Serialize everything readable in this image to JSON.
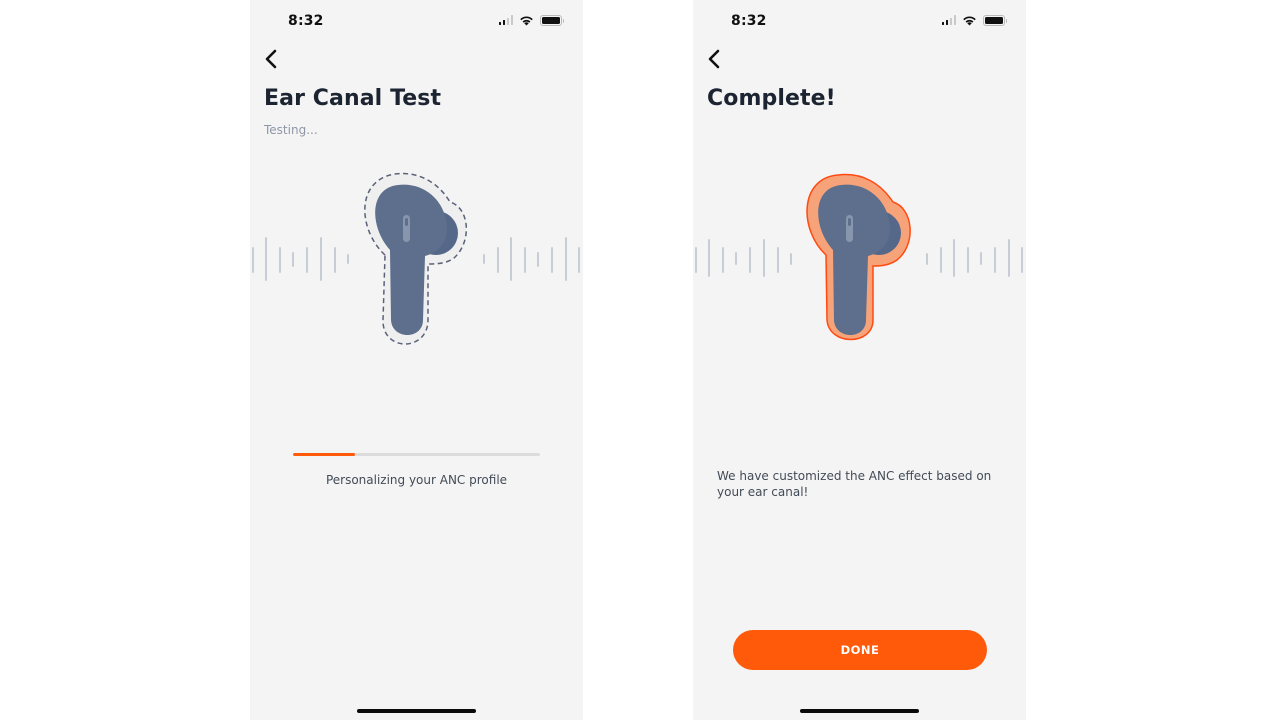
{
  "screens": [
    {
      "status_bar": {
        "time": "8:32",
        "signal_bars": 2,
        "signal_max": 4,
        "wifi": true,
        "battery": "full"
      },
      "back_icon": "chevron-left-icon",
      "title": "Ear Canal Test",
      "subtitle": "Testing...",
      "illustration": {
        "earbud_color": "#5d6f8c",
        "outline_style": "dashed",
        "outline_color": "#5a6278",
        "wave_color": "#c8ccd6"
      },
      "progress": {
        "percent": 25,
        "fill_color": "#ff5a0a",
        "track_color": "#dcdcdc"
      },
      "progress_label": "Personalizing your ANC profile"
    },
    {
      "status_bar": {
        "time": "8:32",
        "signal_bars": 2,
        "signal_max": 4,
        "wifi": true,
        "battery": "full"
      },
      "back_icon": "chevron-left-icon",
      "title": "Complete!",
      "illustration": {
        "earbud_color": "#5d6f8c",
        "outline_style": "filled",
        "outline_fill": "#f7a37a",
        "outline_stroke": "#ff4a12",
        "wave_color": "#c8ccd6"
      },
      "message": "We have customized the ANC effect based on your ear canal!",
      "done_button": {
        "label": "DONE",
        "color": "#ff5a0a"
      }
    }
  ]
}
